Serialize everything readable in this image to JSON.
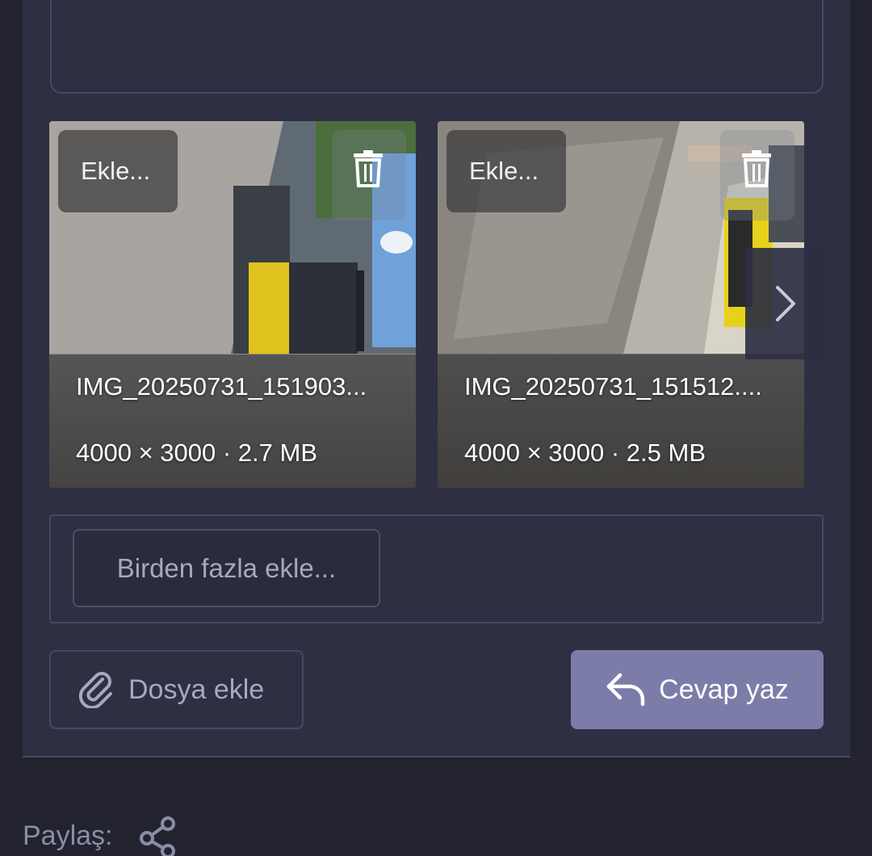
{
  "attachments": [
    {
      "add_label": "Ekle...",
      "filename": "IMG_20250731_151903...",
      "meta": "4000 × 3000 · 2.7 MB"
    },
    {
      "add_label": "Ekle...",
      "filename": "IMG_20250731_151512....",
      "meta": "4000 × 3000 · 2.5 MB"
    }
  ],
  "icons": {
    "delete": "trash-icon",
    "next": "chevron-right-icon",
    "attach": "paperclip-icon",
    "reply": "reply-arrow-icon",
    "share": "share-icon"
  },
  "actions": {
    "add_multiple_label": "Birden fazla ekle...",
    "attach_file_label": "Dosya ekle",
    "reply_label": "Cevap yaz"
  },
  "share": {
    "label": "Paylaş:"
  },
  "colors": {
    "page_bg": "#23232f",
    "panel_bg": "#2e2f42",
    "border": "#474963",
    "primary_button": "#7b7ca8",
    "muted_text": "#a7a8bf"
  }
}
